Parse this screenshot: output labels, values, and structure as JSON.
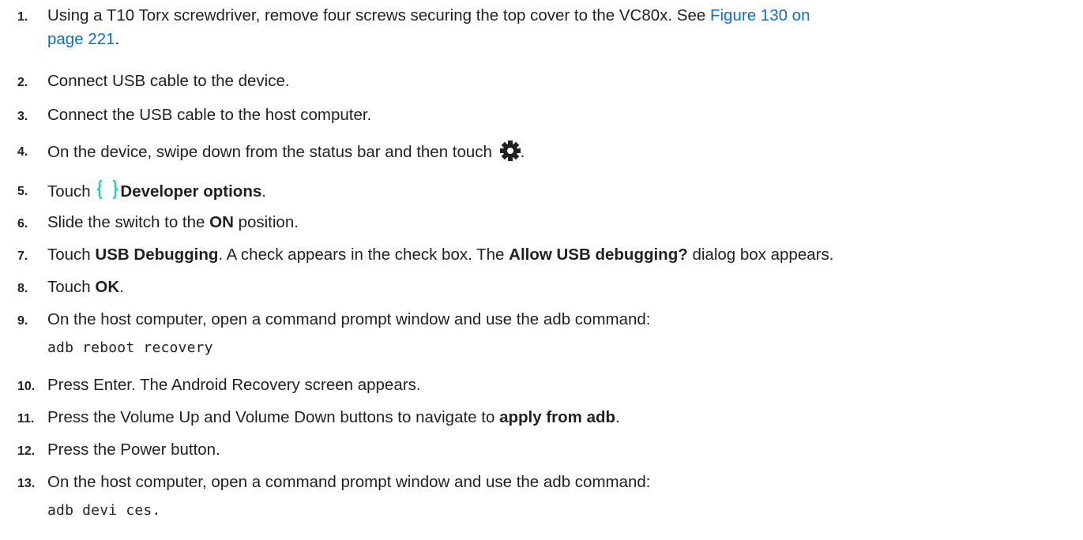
{
  "steps": [
    {
      "number": "1.",
      "parts": {
        "a": "Using a T10 Torx screwdriver, remove four screws securing the top cover to the VC80x. See ",
        "link_line1": "Figure 130 on",
        "link_line2": "page 221",
        "end": "."
      }
    },
    {
      "number": "2.",
      "text": "Connect USB cable to the device."
    },
    {
      "number": "3.",
      "text": "Connect the USB cable to the host computer."
    },
    {
      "number": "4.",
      "text": "On the device, swipe down from the status bar and then touch ",
      "end": ".",
      "icon": "settings-gear-icon"
    },
    {
      "number": "5.",
      "pre": "Touch ",
      "bold": "Developer options",
      "end": ".",
      "icon": "developer-options-braces-icon"
    },
    {
      "number": "6.",
      "pre": "Slide the switch to the ",
      "bold": "ON",
      "post": " position."
    },
    {
      "number": "7.",
      "pre": "Touch ",
      "bold1": "USB Debugging",
      "mid": ". A check appears in the check box. The ",
      "bold2": "Allow USB debugging?",
      "post": " dialog box appears."
    },
    {
      "number": "8.",
      "pre": "Touch ",
      "bold": "OK",
      "end": "."
    },
    {
      "number": "9.",
      "text": "On the host computer, open a command prompt window and use the adb command:",
      "code": "adb reboot recovery"
    },
    {
      "number": "10.",
      "text": "Press Enter. The Android Recovery screen appears."
    },
    {
      "number": "11.",
      "pre": "Press the Volume Up and Volume Down buttons to navigate to ",
      "bold": "apply from adb",
      "end": "."
    },
    {
      "number": "12.",
      "text": "Press the Power button."
    },
    {
      "number": "13.",
      "text": "On the host computer, open a command prompt window and use the adb command:",
      "code": "adb devi ces."
    }
  ],
  "colors": {
    "text": "#231f20",
    "link": "#0a6ed1",
    "braces_icon": "#19d0b0"
  }
}
